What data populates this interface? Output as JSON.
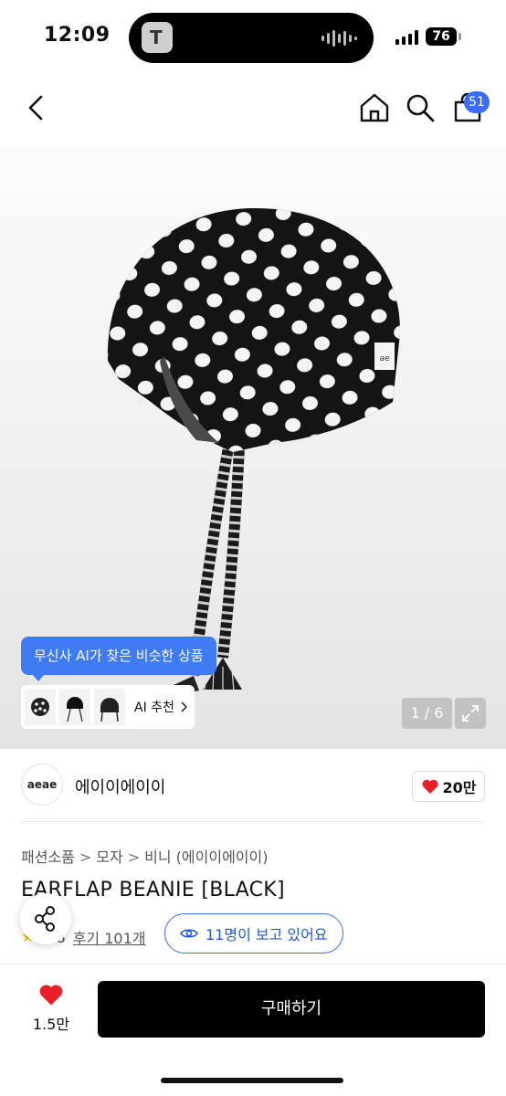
{
  "status_bar": {
    "time": "12:09",
    "battery": "76"
  },
  "header": {
    "cart_count": "51"
  },
  "gallery": {
    "ai_tooltip": "무신사 AI가 찾은 비슷한 상품",
    "ai_recommend_label": "AI 추천",
    "page_indicator": "1 / 6"
  },
  "brand": {
    "logo_text": "aeae",
    "name": "에이이에이이",
    "likes": "20만"
  },
  "breadcrumb": [
    "패션소품",
    "모자",
    "비니 (에이이에이이)"
  ],
  "product": {
    "title": "EARFLAP BEANIE [BLACK]",
    "rating": "4.8",
    "review_link": "후기 101개",
    "viewers": "11명이 보고 있어요"
  },
  "bottom_bar": {
    "wish_count": "1.5만",
    "buy_label": "구매하기"
  },
  "colors": {
    "accent": "#3a6cf4",
    "heart": "#e8202a",
    "buy_bg": "#000000"
  }
}
